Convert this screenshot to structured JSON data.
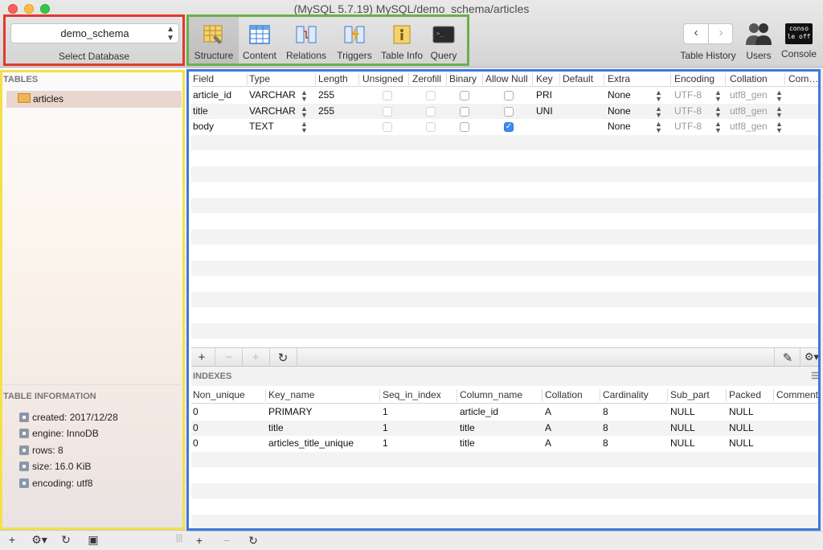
{
  "window": {
    "title": "(MySQL 5.7.19) MySQL/demo_schema/articles"
  },
  "database_selector": {
    "value": "demo_schema",
    "label": "Select Database"
  },
  "toolbar": {
    "tabs": [
      {
        "label": "Structure",
        "icon": "structure-icon",
        "active": true
      },
      {
        "label": "Content",
        "icon": "content-icon",
        "active": false
      },
      {
        "label": "Relations",
        "icon": "relations-icon",
        "active": false
      },
      {
        "label": "Triggers",
        "icon": "triggers-icon",
        "active": false
      },
      {
        "label": "Table Info",
        "icon": "table-info-icon",
        "active": false
      },
      {
        "label": "Query",
        "icon": "query-icon",
        "active": false
      }
    ],
    "right": {
      "history_label": "Table History",
      "users_label": "Users",
      "console_label": "Console",
      "console_icon_text": "conso le off"
    }
  },
  "sidebar": {
    "tables_header": "TABLES",
    "tables": [
      "articles"
    ],
    "info_header": "TABLE INFORMATION",
    "info": [
      "created: 2017/12/28",
      "engine: InnoDB",
      "rows: 8",
      "size: 16.0 KiB",
      "encoding: utf8"
    ]
  },
  "structure": {
    "columns": [
      "Field",
      "Type",
      "Length",
      "Unsigned",
      "Zerofill",
      "Binary",
      "Allow Null",
      "Key",
      "Default",
      "Extra",
      "Encoding",
      "Collation",
      "Com…"
    ],
    "rows": [
      {
        "field": "article_id",
        "type": "VARCHAR",
        "length": "255",
        "unsigned": false,
        "zerofill": false,
        "binary": false,
        "allow_null": false,
        "key": "PRI",
        "default": "",
        "extra": "None",
        "encoding": "UTF-8",
        "collation": "utf8_gen"
      },
      {
        "field": "title",
        "type": "VARCHAR",
        "length": "255",
        "unsigned": false,
        "zerofill": false,
        "binary": false,
        "allow_null": false,
        "key": "UNI",
        "default": "",
        "extra": "None",
        "encoding": "UTF-8",
        "collation": "utf8_gen"
      },
      {
        "field": "body",
        "type": "TEXT",
        "length": "",
        "unsigned": false,
        "zerofill": false,
        "binary": false,
        "allow_null": true,
        "key": "",
        "default": "",
        "extra": "None",
        "encoding": "UTF-8",
        "collation": "utf8_gen"
      }
    ]
  },
  "indexes": {
    "title": "INDEXES",
    "columns": [
      "Non_unique",
      "Key_name",
      "Seq_in_index",
      "Column_name",
      "Collation",
      "Cardinality",
      "Sub_part",
      "Packed",
      "Comment"
    ],
    "rows": [
      [
        "0",
        "PRIMARY",
        "1",
        "article_id",
        "A",
        "8",
        "NULL",
        "NULL",
        ""
      ],
      [
        "0",
        "title",
        "1",
        "title",
        "A",
        "8",
        "NULL",
        "NULL",
        ""
      ],
      [
        "0",
        "articles_title_unique",
        "1",
        "title",
        "A",
        "8",
        "NULL",
        "NULL",
        ""
      ]
    ]
  },
  "colors": {
    "db_highlight": "#e0392b",
    "toolbar_highlight": "#6ab04c",
    "sidebar_highlight": "#f3e04a",
    "main_highlight": "#3d78e0",
    "checkbox_checked": "#3b8cf2"
  }
}
